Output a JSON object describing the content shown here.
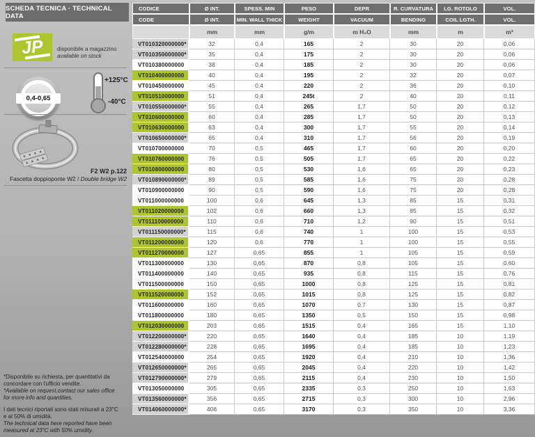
{
  "colors": {
    "accent_green": "#afc52d",
    "header_gray": "#6f6f6f",
    "unit_row_bg": "#dadada",
    "starred_row_bg": "#d2d2d2",
    "page_background": "#b3b3b3"
  },
  "sidebar": {
    "title": "SCHEDA TECNICA · TECHNICAL DATA",
    "logo_text": "JP",
    "stock_label_it": "disponibile a magazzino",
    "stock_label_en": "available on stock",
    "thickness_badge": "0,4-0,65",
    "temp_max": "+125°C",
    "temp_min": "-40°C",
    "clamp_ref": "F2 W2 p.122",
    "clamp_desc_it": "Fascetta doppioponte W2",
    "clamp_desc_sep": " / ",
    "clamp_desc_en": "Double bridge W2",
    "footnotes": {
      "note1_it": "*Disponibile su richiesta, per quantitativi da\nconcordare con l'ufficio vendite.",
      "note1_en": "*Available on request,contact our sales office\nfor more info and quantities.",
      "note2_it": "I dati tecnici riportati sono stati misurati a 23°C\ne al 50% di umidità.",
      "note2_en": "The technical data here reported have been\nmeasured at 23°C with 50% umidity."
    }
  },
  "table": {
    "header_row1": [
      "CODICE",
      "Ø INT.",
      "SPESS. MIN",
      "PESO",
      "DEPR",
      "R. CURVATURA",
      "LG. ROTOLO",
      "VOL."
    ],
    "header_row2": [
      "CODE",
      "Ø INT.",
      "MIN. WALL THICK",
      "WEIGHT",
      "VACUUM",
      "BENDING",
      "COIL LGTH.",
      "VOL."
    ],
    "units": [
      "",
      "mm",
      "mm",
      "g/m",
      "m H₂O",
      "mm",
      "m",
      "m³"
    ],
    "legend": {
      "stock": "available on stock (green)",
      "request": "available on request (gray, *)"
    },
    "rows": [
      {
        "code": "VT010320000000*",
        "variant": "request",
        "values": [
          "32",
          "0,4",
          "165",
          "2",
          "30",
          "20",
          "0,06"
        ]
      },
      {
        "code": "VT010350000000*",
        "variant": "request",
        "values": [
          "35",
          "0,4",
          "175",
          "2",
          "30",
          "20",
          "0,06"
        ]
      },
      {
        "code": "VT010380000000",
        "variant": "standard",
        "values": [
          "38",
          "0,4",
          "185",
          "2",
          "30",
          "20",
          "0,06"
        ]
      },
      {
        "code": "VT010400000000",
        "variant": "stock",
        "values": [
          "40",
          "0,4",
          "195",
          "2",
          "32",
          "20",
          "0,07"
        ]
      },
      {
        "code": "VT010450000000",
        "variant": "standard",
        "values": [
          "45",
          "0,4",
          "220",
          "2",
          "36",
          "20",
          "0,10"
        ]
      },
      {
        "code": "VT010510000000",
        "variant": "stock",
        "values": [
          "51",
          "0,4",
          "245t",
          "2",
          "40",
          "20",
          "0,11"
        ]
      },
      {
        "code": "VT010550000000*",
        "variant": "request",
        "values": [
          "55",
          "0,4",
          "265",
          "1,7",
          "50",
          "20",
          "0,12"
        ]
      },
      {
        "code": "VT010600000000",
        "variant": "stock",
        "values": [
          "60",
          "0,4",
          "285",
          "1,7",
          "50",
          "20",
          "0,13"
        ]
      },
      {
        "code": "VT010630000000",
        "variant": "stock",
        "values": [
          "63",
          "0,4",
          "300",
          "1,7",
          "55",
          "20",
          "0,14"
        ]
      },
      {
        "code": "VT010650000000*",
        "variant": "request",
        "values": [
          "65",
          "0,4",
          "310",
          "1,7",
          "56",
          "20",
          "0,19"
        ]
      },
      {
        "code": "VT010700000000",
        "variant": "standard",
        "values": [
          "70",
          "0,5",
          "465",
          "1,7",
          "60",
          "20",
          "0,20"
        ]
      },
      {
        "code": "VT010760000000",
        "variant": "stock",
        "values": [
          "76",
          "0,5",
          "505",
          "1,7",
          "65",
          "20",
          "0,22"
        ]
      },
      {
        "code": "VT010800000000",
        "variant": "stock",
        "values": [
          "80",
          "0,5",
          "530",
          "1,6",
          "65",
          "20",
          "0,23"
        ]
      },
      {
        "code": "VT010890000000*",
        "variant": "request",
        "values": [
          "89",
          "0,5",
          "585",
          "1,6",
          "75",
          "20",
          "0,28"
        ]
      },
      {
        "code": "VT010900000000",
        "variant": "standard",
        "values": [
          "90",
          "0,5",
          "590",
          "1,6",
          "75",
          "20",
          "0,28"
        ]
      },
      {
        "code": "VT011000000000",
        "variant": "standard",
        "values": [
          "100",
          "0,6",
          "645",
          "1,3",
          "85",
          "15",
          "0,31"
        ]
      },
      {
        "code": "VT011020000000",
        "variant": "stock",
        "values": [
          "102",
          "0,6",
          "660",
          "1,3",
          "85",
          "15",
          "0,32"
        ]
      },
      {
        "code": "VT011100000000",
        "variant": "stock",
        "values": [
          "110",
          "0,6",
          "710",
          "1,2",
          "90",
          "15",
          "0,51"
        ]
      },
      {
        "code": "VT011150000000*",
        "variant": "request",
        "values": [
          "115",
          "0,6",
          "740",
          "1",
          "100",
          "15",
          "0,53"
        ]
      },
      {
        "code": "VT011200000000",
        "variant": "stock",
        "values": [
          "120",
          "0,6",
          "770",
          "1",
          "100",
          "15",
          "0,55"
        ]
      },
      {
        "code": "VT011270000000",
        "variant": "stock",
        "values": [
          "127",
          "0,65",
          "855",
          "1",
          "105",
          "15",
          "0,59"
        ]
      },
      {
        "code": "VT011300000000",
        "variant": "standard",
        "values": [
          "130",
          "0,65",
          "870",
          "0,8",
          "105",
          "15",
          "0,60"
        ]
      },
      {
        "code": "VT011400000000",
        "variant": "standard",
        "values": [
          "140",
          "0,65",
          "935",
          "0,8",
          "115",
          "15",
          "0,76"
        ]
      },
      {
        "code": "VT011500000000",
        "variant": "standard",
        "values": [
          "150",
          "0,65",
          "1000",
          "0,8",
          "125",
          "15",
          "0,81"
        ]
      },
      {
        "code": "VT011520000000",
        "variant": "stock",
        "values": [
          "152",
          "0,65",
          "1015",
          "0,8",
          "125",
          "15",
          "0,82"
        ]
      },
      {
        "code": "VT011600000000",
        "variant": "standard",
        "values": [
          "160",
          "0,65",
          "1070",
          "0,7",
          "130",
          "15",
          "0,87"
        ]
      },
      {
        "code": "VT011800000000",
        "variant": "standard",
        "values": [
          "180",
          "0,65",
          "1350",
          "0,5",
          "150",
          "15",
          "0,98"
        ]
      },
      {
        "code": "VT012030000000",
        "variant": "stock",
        "values": [
          "203",
          "0,65",
          "1515",
          "0,4",
          "165",
          "15",
          "1,10"
        ]
      },
      {
        "code": "VT012200000000*",
        "variant": "request",
        "values": [
          "220",
          "0,65",
          "1640",
          "0,4",
          "185",
          "10",
          "1,19"
        ]
      },
      {
        "code": "VT012280000000*",
        "variant": "request",
        "values": [
          "228",
          "0,65",
          "1695",
          "0,4",
          "185",
          "10",
          "1,23"
        ]
      },
      {
        "code": "VT012540000000",
        "variant": "standard",
        "values": [
          "254",
          "0,65",
          "1920",
          "0,4",
          "210",
          "10",
          "1,36"
        ]
      },
      {
        "code": "VT012650000000*",
        "variant": "request",
        "values": [
          "265",
          "0,65",
          "2045",
          "0,4",
          "220",
          "10",
          "1,42"
        ]
      },
      {
        "code": "VT012790000000*",
        "variant": "request",
        "values": [
          "279",
          "0,65",
          "2115",
          "0,4",
          "230",
          "10",
          "1,50"
        ]
      },
      {
        "code": "VT013050000000",
        "variant": "standard",
        "values": [
          "305",
          "0,65",
          "2335",
          "0,3",
          "250",
          "10",
          "1,63"
        ]
      },
      {
        "code": "VT013560000000*",
        "variant": "request",
        "values": [
          "356",
          "0,65",
          "2715",
          "0,3",
          "300",
          "10",
          "2,96"
        ]
      },
      {
        "code": "VT014060000000*",
        "variant": "request",
        "values": [
          "406",
          "0,65",
          "3170",
          "0,3",
          "350",
          "10",
          "3,36"
        ]
      }
    ]
  }
}
